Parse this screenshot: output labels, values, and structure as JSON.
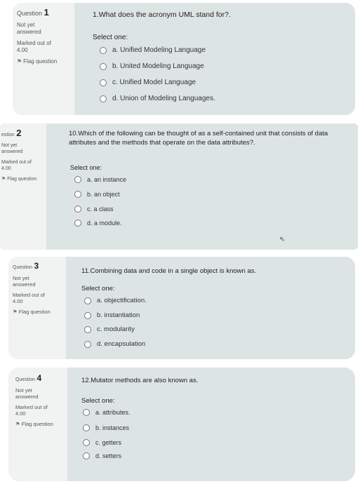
{
  "questions": [
    {
      "number_prefix": "Question",
      "number": "1",
      "status": [
        "Not yet",
        "answered"
      ],
      "marked_label": "Marked out of",
      "marked_value": "4.00",
      "flag_label": "Flag question",
      "text": "1.What does the acronym UML stand for?.",
      "select_one": "Select one:",
      "options": [
        "a. Unified Modeling Language",
        "b. United Modeling Language",
        "c. Unified Model Language",
        "d. Union of Modeling Languages."
      ]
    },
    {
      "number_prefix": "estion",
      "number": "2",
      "status": [
        "Not yet",
        "answered"
      ],
      "marked_label": "Marked out of",
      "marked_value": "4.00",
      "flag_label": "Flag question",
      "text": "10.Which of the following can be thought of as a self-contained unit that consists of data attributes and the methods that operate on the data attributes?.",
      "select_one": "Select one:",
      "options": [
        "a. an instance",
        "b. an object",
        "c. a class",
        "d. a module."
      ]
    },
    {
      "number_prefix": "Question",
      "number": "3",
      "status": [
        "Not yet",
        "answered"
      ],
      "marked_label": "Marked out of",
      "marked_value": "4.00",
      "flag_label": "Flag question",
      "text": "11.Combining data and code in a single object is known as.",
      "select_one": "Select one:",
      "options": [
        "a. objectification.",
        "b. instantiation",
        "c. modularity",
        "d. encapsulation"
      ]
    },
    {
      "number_prefix": "Question",
      "number": "4",
      "status": [
        "Not yet",
        "answered"
      ],
      "marked_label": "Marked out of",
      "marked_value": "4.00",
      "flag_label": "Flag question",
      "text": "12.Mutator methods are also known as.",
      "select_one": "Select one:",
      "options": [
        "a. attributes.",
        "b. instances",
        "c. getters",
        "d. setters"
      ]
    }
  ]
}
